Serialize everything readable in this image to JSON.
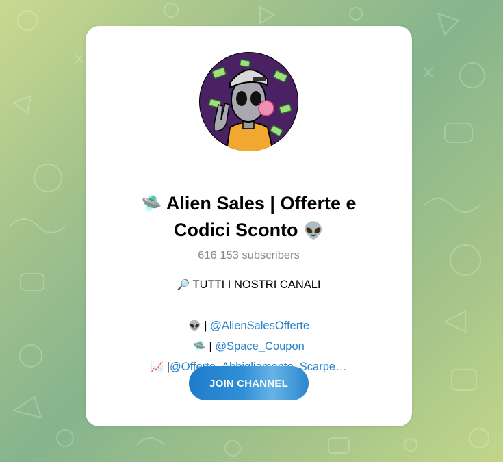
{
  "channel": {
    "title_icon": "ufo-emoji",
    "title_text": "Alien Sales | Offerte e Codici Sconto",
    "title_end_icon": "alien-emoji",
    "title_prefix_emoji": "🛸",
    "title_suffix_emoji": "👽",
    "subscribers": "616 153 subscribers",
    "avatar_icon": "alien-mascot-avatar"
  },
  "description": {
    "heading_icon": "magnifier-emoji",
    "heading_emoji": "🔎",
    "heading": "TUTTI I NOSTRI CANALI",
    "links": [
      {
        "icon": "alien-emoji",
        "emoji": "👽",
        "separator": " | ",
        "handle": "@AlienSalesOfferte"
      },
      {
        "icon": "ufo-emoji",
        "emoji": "🛸",
        "separator": " | ",
        "handle": "@Space_Coupon"
      },
      {
        "icon": "chart-emoji",
        "emoji": "📈",
        "separator": " |",
        "handle": "@Offerte_Abbigliamento_Scarpe…"
      }
    ]
  },
  "join_button": {
    "label": "JOIN CHANNEL"
  },
  "colors": {
    "link": "#2481cc",
    "button": "#2481cc",
    "background": "#9fc08c",
    "subtitle": "#8a8a8a"
  }
}
